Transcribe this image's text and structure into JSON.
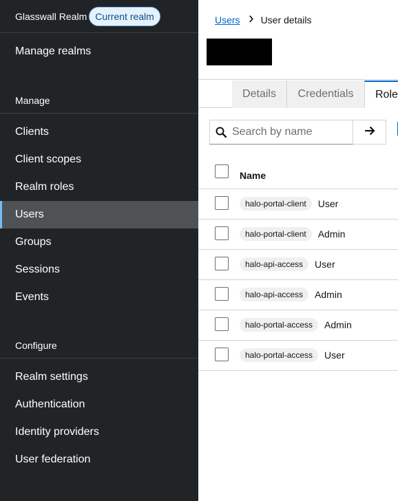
{
  "realm": {
    "name": "Glasswall Realm",
    "badge": "Current realm"
  },
  "sidebar": {
    "manage_realms": "Manage realms",
    "manage_section": "Manage",
    "manage_items": [
      "Clients",
      "Client scopes",
      "Realm roles",
      "Users",
      "Groups",
      "Sessions",
      "Events"
    ],
    "configure_section": "Configure",
    "configure_items": [
      "Realm settings",
      "Authentication",
      "Identity providers",
      "User federation"
    ],
    "active_item": "Users"
  },
  "breadcrumb": {
    "link": "Users",
    "current": "User details"
  },
  "tabs": [
    "Details",
    "Credentials",
    "Role"
  ],
  "active_tab": "Role",
  "search": {
    "placeholder": "Search by name",
    "value": ""
  },
  "table": {
    "header": "Name",
    "rows": [
      {
        "client": "halo-portal-client",
        "role": "User"
      },
      {
        "client": "halo-portal-client",
        "role": "Admin"
      },
      {
        "client": "halo-api-access",
        "role": "User"
      },
      {
        "client": "halo-api-access",
        "role": "Admin"
      },
      {
        "client": "halo-portal-access",
        "role": "Admin"
      },
      {
        "client": "halo-portal-access",
        "role": "User"
      }
    ]
  },
  "colors": {
    "sidebar_bg": "#212427",
    "active_nav_bg": "#4f5255",
    "accent": "#0066cc",
    "badge_bg": "#e7f1fa"
  },
  "icons": {
    "breadcrumb_separator": "chevron-right-icon",
    "search": "search-icon",
    "search_submit": "arrow-right-icon"
  }
}
